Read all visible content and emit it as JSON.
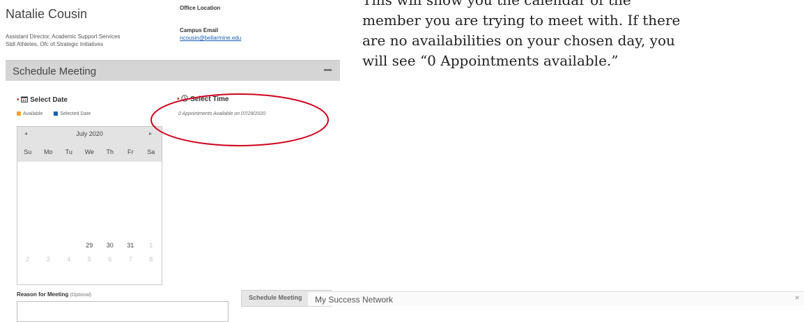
{
  "profile": {
    "name": "Natalie Cousin",
    "title_line1": "Assistant Director, Academic Support Services",
    "title_line2": "Stdt Athletes, Ofc of Strategic Initiatives",
    "office_location_label": "Office Location",
    "campus_email_label": "Campus Email",
    "campus_email": "ncousin@bellarmine.edu"
  },
  "panel": {
    "title": "Schedule Meeting",
    "collapse_symbol": "−"
  },
  "date_section": {
    "required_marker": "•",
    "icon": "calendar-icon",
    "title": "Select Date",
    "legend_available": "Available",
    "legend_selected": "Selected Date",
    "colors": {
      "available": "#f5a623",
      "selected": "#1a5fb4"
    }
  },
  "calendar": {
    "prev": "◂",
    "next": "▸",
    "month_label": "July 2020",
    "weekdays": [
      "Su",
      "Mo",
      "Tu",
      "We",
      "Th",
      "Fr",
      "Sa"
    ],
    "week5": [
      "29",
      "30",
      "31",
      "1"
    ],
    "week6": [
      "2",
      "3",
      "4",
      "5",
      "6",
      "7",
      "8"
    ]
  },
  "time_section": {
    "required_marker": "•",
    "icon": "clock-icon",
    "title": "Select Time",
    "availability_text": "0 Appointments Available on 07/29/2020"
  },
  "reason": {
    "label": "Reason for Meeting",
    "optional": "(Optional)",
    "value": ""
  },
  "schedule_button": "Schedule Meeting",
  "network": {
    "title": "My Success Network"
  },
  "instructions": {
    "line1": "This will show you the calendar of the",
    "line2": "member you are trying to meet with. If there",
    "line3": "are no availabilities on your chosen day, you",
    "line4": "will see “0 Appointments available.”"
  },
  "annotation_color": "#d0021b"
}
